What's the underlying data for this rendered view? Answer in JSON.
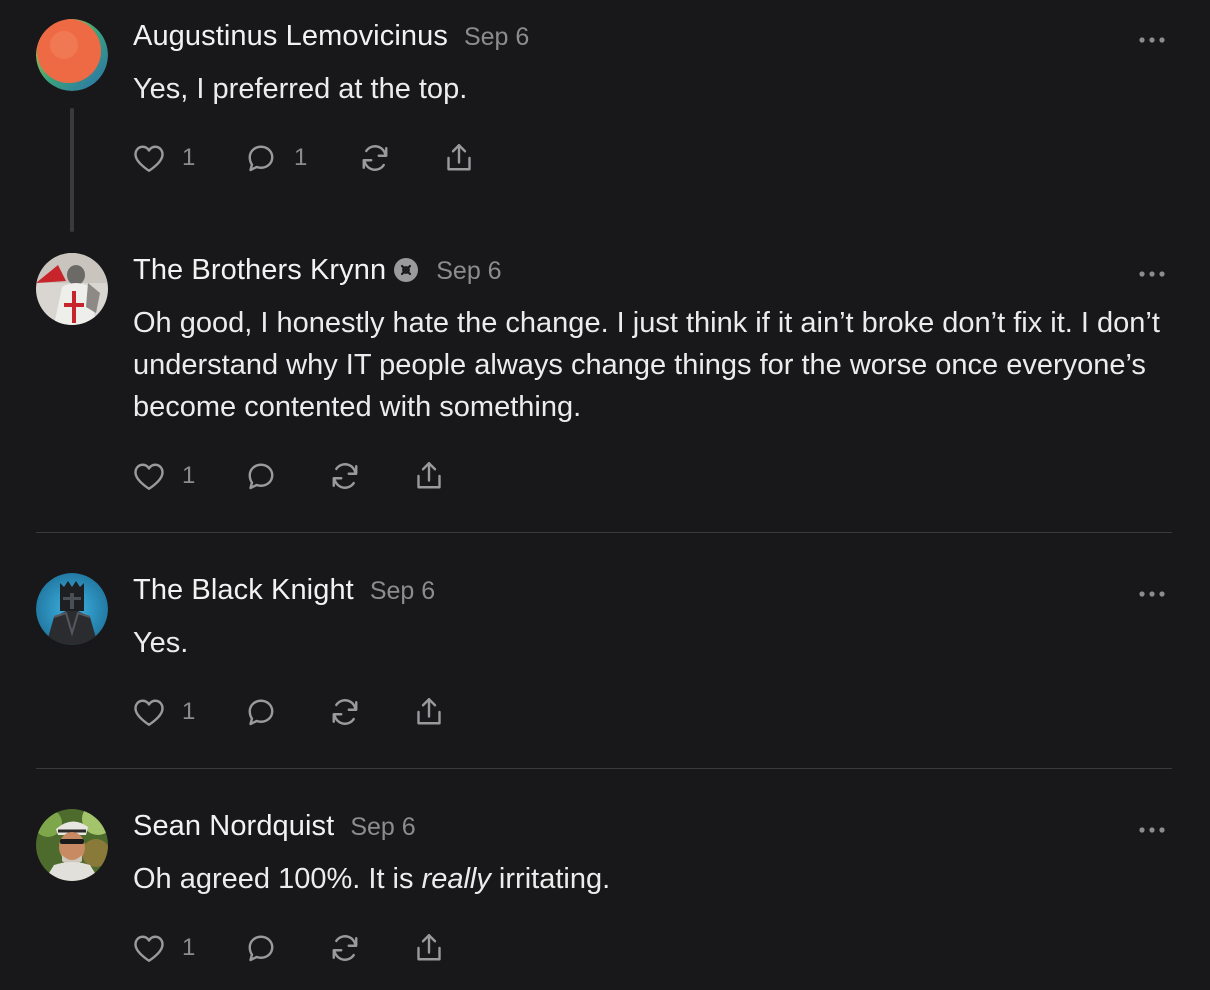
{
  "comments": [
    {
      "author": "Augustinus Lemovicinus",
      "date": "Sep 6",
      "text": "Yes, I preferred at the top.",
      "likes": "1",
      "replies": "1",
      "avatar": "orange-gradient-circle"
    },
    {
      "author": "The Brothers Krynn",
      "date": "Sep 6",
      "text": "Oh good, I honestly hate the change. I just think if it ain’t broke don’t fix it. I don’t understand why IT people always change things for the worse once everyone’s become contented with something.",
      "likes": "1",
      "badge": "founding-member-badge-icon",
      "avatar": "knight-templar-photo"
    },
    {
      "author": "The Black Knight",
      "date": "Sep 6",
      "text": "Yes.",
      "likes": "1",
      "avatar": "black-knight-helmet"
    },
    {
      "author": "Sean Nordquist",
      "date": "Sep 6",
      "text_before": "Oh agreed 100%. It is ",
      "text_emphasis": "really",
      "text_after": " irritating.",
      "likes": "1",
      "avatar": "man-outdoor-photo"
    }
  ],
  "colors": {
    "background": "#18181a",
    "text": "#ececec",
    "muted": "#8c8c8f",
    "divider": "#3a3a3c"
  }
}
